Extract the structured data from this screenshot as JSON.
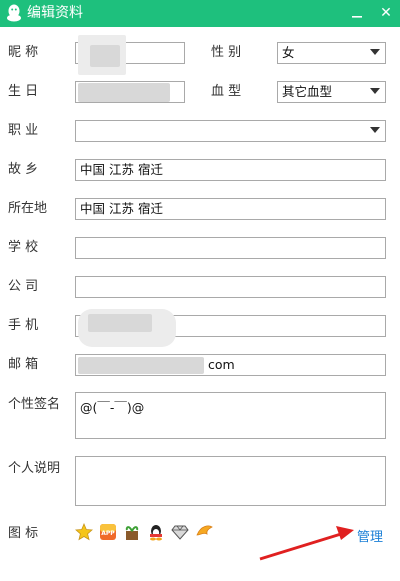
{
  "window": {
    "title": "编辑资料",
    "close": "✕"
  },
  "labels": {
    "nickname": "昵  称",
    "gender": "性  别",
    "birthday": "生  日",
    "blood_type": "血  型",
    "occupation": "职  业",
    "hometown": "故  乡",
    "location": "所在地",
    "school": "学  校",
    "company": "公  司",
    "phone": "手  机",
    "email": "邮  箱",
    "signature": "个性签名",
    "description": "个人说明",
    "icons": "图  标"
  },
  "fields": {
    "nickname": "",
    "gender": "女",
    "birthday": "",
    "blood_type": "其它血型",
    "occupation": "",
    "hometown": "中国  江苏  宿迁",
    "location": "中国  江苏  宿迁",
    "school": "",
    "company": "",
    "phone": "",
    "email_suffix": "com",
    "signature": "@(￣-￣)@",
    "description": ""
  },
  "icons": [
    "star-badge-icon",
    "app-badge-icon",
    "plant-badge-icon",
    "qq-penguin-badge-icon",
    "diamond-badge-icon",
    "wing-badge-icon"
  ],
  "actions": {
    "manage": "管理"
  },
  "colors": {
    "titlebar": "#1ec07d",
    "link": "#1a7fd6",
    "annotation_arrow": "#e02020"
  }
}
